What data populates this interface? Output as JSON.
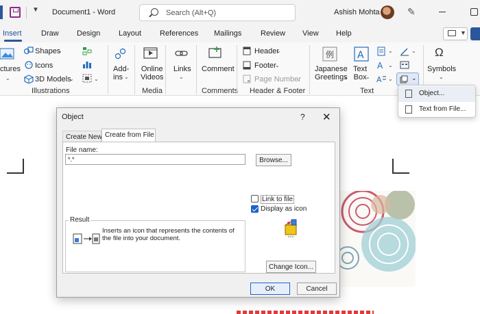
{
  "titlebar": {
    "document_title": "Document1  -  Word",
    "search_placeholder": "Search (Alt+Q)",
    "user_name": "Ashish Mohta"
  },
  "tabs": [
    "Insert",
    "Draw",
    "Design",
    "Layout",
    "References",
    "Mailings",
    "Review",
    "View",
    "Help"
  ],
  "ribbon": {
    "pictures": "ctures",
    "shapes": "Shapes",
    "icons": "Icons",
    "models_3d": "3D Models",
    "addins": "Add-\nins",
    "online_videos": "Online\nVideos",
    "links": "Links",
    "comment": "Comment",
    "header": "Header",
    "footer": "Footer",
    "page_number": "Page Number",
    "japanese_greetings": "Japanese\nGreetings",
    "text_box": "Text\nBox",
    "symbols": "Symbols",
    "groups": {
      "illustrations": "Illustrations",
      "media": "Media",
      "comments": "Comments",
      "header_footer": "Header & Footer",
      "text": "Text"
    }
  },
  "object_menu": {
    "object": "Object...",
    "text_from_file": "Text from File..."
  },
  "dialog": {
    "title": "Object",
    "help": "?",
    "tab_create_new": "Create New",
    "tab_create_from_file": "Create from File",
    "file_name_label": "File name:",
    "file_name_value": "*.*",
    "browse": "Browse...",
    "link_to_file": "Link to file",
    "display_as_icon": "Display as icon",
    "result_label": "Result",
    "result_text": "Inserts an icon that represents the contents of the file into your document.",
    "change_icon": "Change Icon...",
    "ok": "OK",
    "cancel": "Cancel",
    "link_to_file_checked": false,
    "display_as_icon_checked": true
  },
  "colors": {
    "accent": "#2b579a",
    "checkbox": "#1c64c8"
  }
}
